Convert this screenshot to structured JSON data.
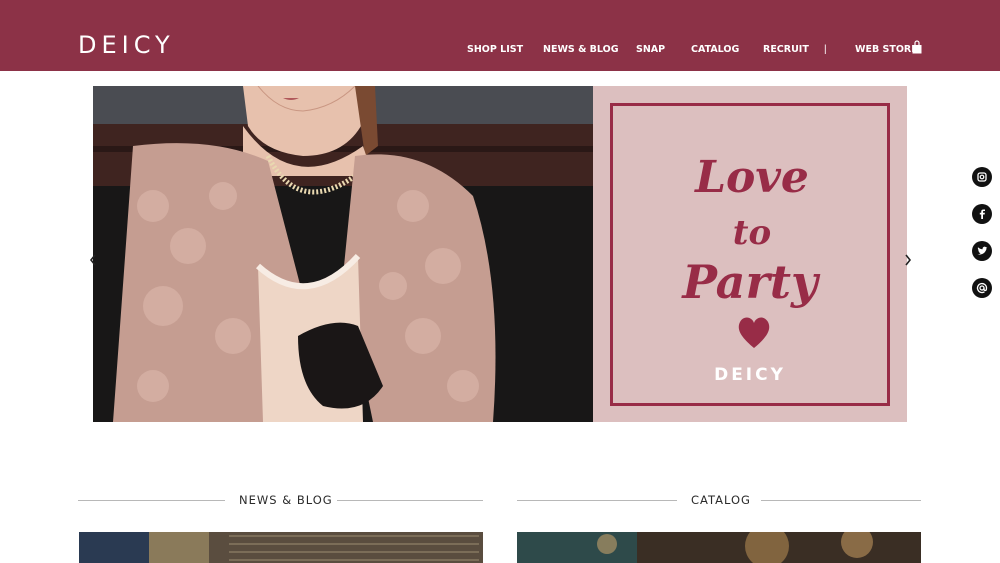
{
  "header": {
    "logo": "DEICY",
    "nav": [
      {
        "label": "SHOP LIST"
      },
      {
        "label": "NEWS & BLOG"
      },
      {
        "label": "SNAP"
      },
      {
        "label": "CATALOG"
      },
      {
        "label": "RECRUIT"
      }
    ],
    "separator": "|",
    "web_store": "WEB STORE"
  },
  "hero": {
    "promo_lines": [
      "Love",
      "to",
      "Party"
    ],
    "promo_brand": "DEICY"
  },
  "sections": {
    "news": {
      "title": "NEWS & BLOG"
    },
    "catalog": {
      "title": "CATALOG"
    }
  },
  "social": [
    "instagram-icon",
    "facebook-icon",
    "twitter-icon",
    "mail-icon"
  ],
  "colors": {
    "brand": "#8c3247",
    "promo_bg": "#dcbfbf",
    "promo_accent": "#982c47"
  }
}
